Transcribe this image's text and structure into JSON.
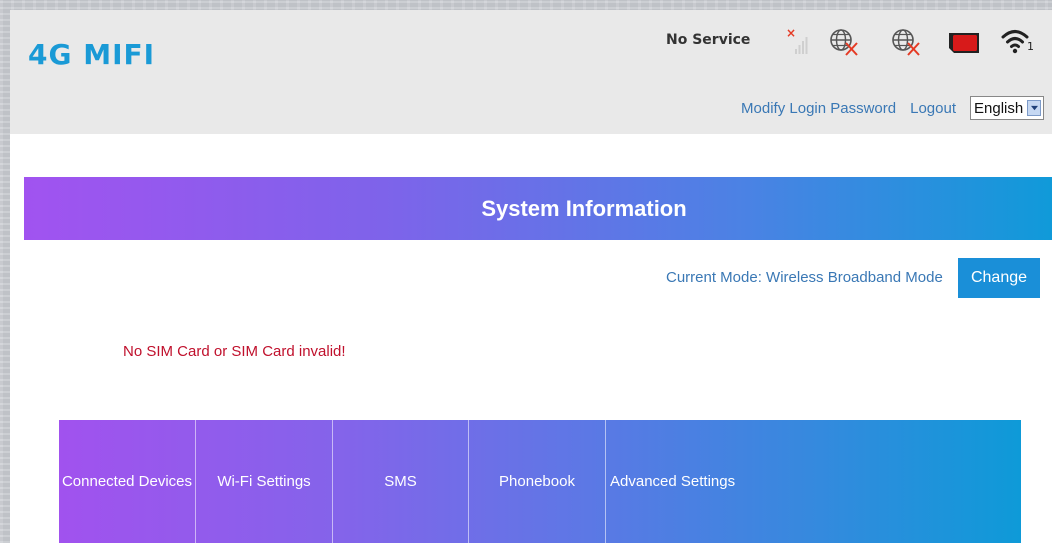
{
  "header": {
    "logo": "4G MIFI",
    "status": "No Service",
    "links": {
      "modify_password": "Modify Login Password",
      "logout": "Logout"
    },
    "language": {
      "selected": "English"
    },
    "icons": {
      "signal": "signal-no-service-icon",
      "internet_1": "globe-disconnected-icon",
      "internet_2": "globe-disconnected-icon",
      "sim": "sim-card-icon",
      "wifi": "wifi-icon"
    },
    "wifi_count": "1",
    "colors": {
      "logo": "#1a9ad6",
      "error_x": "#e53a24",
      "sim": "#d71a1a"
    }
  },
  "banner": {
    "title": "System Information",
    "gradient_start": "#a153f0",
    "gradient_end": "#109ad9"
  },
  "mode": {
    "label": "Current Mode: Wireless Broadband Mode",
    "button": "Change",
    "button_color": "#1a8fd8"
  },
  "warning": {
    "text": "No SIM Card or SIM Card invalid!",
    "color": "#c0102c"
  },
  "nav": {
    "items": [
      {
        "label": "Connected Devices"
      },
      {
        "label": "Wi-Fi Settings"
      },
      {
        "label": "SMS"
      },
      {
        "label": "Phonebook"
      },
      {
        "label": "Advanced Settings"
      }
    ]
  }
}
